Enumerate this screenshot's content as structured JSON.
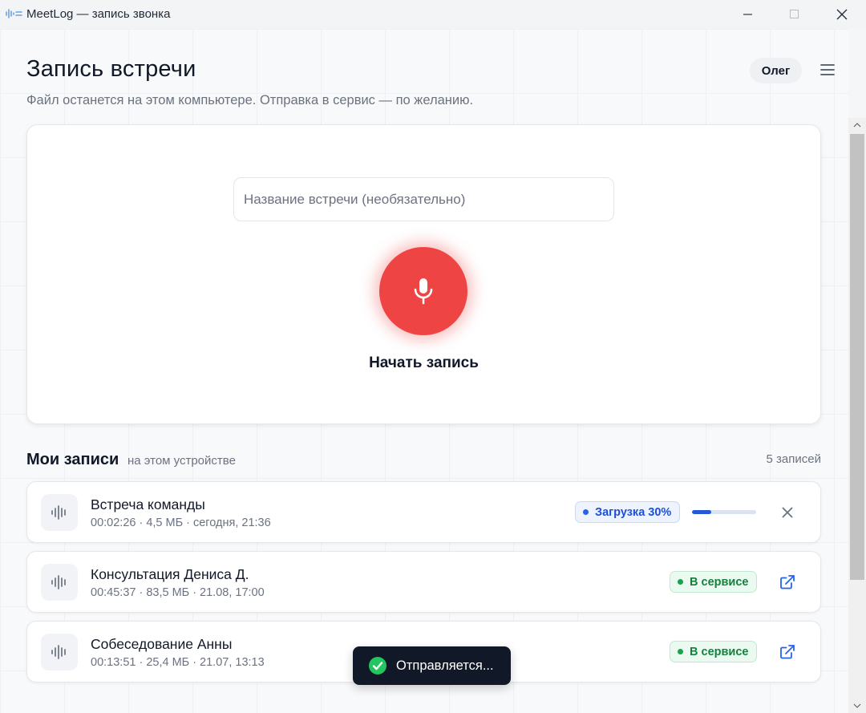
{
  "window": {
    "title": "MeetLog — запись звонка"
  },
  "header": {
    "page_title": "Запись встречи",
    "subtitle": "Файл останется на этом компьютере. Отправка в сервис — по желанию.",
    "user_name": "Олег"
  },
  "recorder": {
    "meeting_name_value": "",
    "meeting_name_placeholder": "Название встречи (необязательно)",
    "start_label": "Начать запись"
  },
  "records": {
    "title": "Мои записи",
    "subtitle": "на этом устройстве",
    "count_label": "5 записей",
    "items": [
      {
        "title": "Встреча команды",
        "meta": "00:02:26 · 4,5 МБ · сегодня, 21:36",
        "status": "Загрузка 30%",
        "progress": 0.3,
        "action_icon": "close-icon"
      },
      {
        "title": "Консультация Дениса Д.",
        "meta": "00:45:37 · 83,5 МБ · 21.08, 17:00",
        "status": "В сервисе",
        "action_icon": "external-link-icon"
      },
      {
        "title": "Собеседование Анны",
        "meta": "00:13:51 · 25,4 МБ · 21.07, 13:13",
        "status": "В сервисе",
        "action_icon": "external-link-icon"
      }
    ]
  },
  "toast": {
    "text": "Отправляется...",
    "icon": "check-circle-icon"
  },
  "colors": {
    "record_button": "#ef4444",
    "upload_badge": "#1d4ed8",
    "success_badge": "#15803d",
    "toast_bg": "#111827",
    "link_icon": "#2563eb"
  }
}
